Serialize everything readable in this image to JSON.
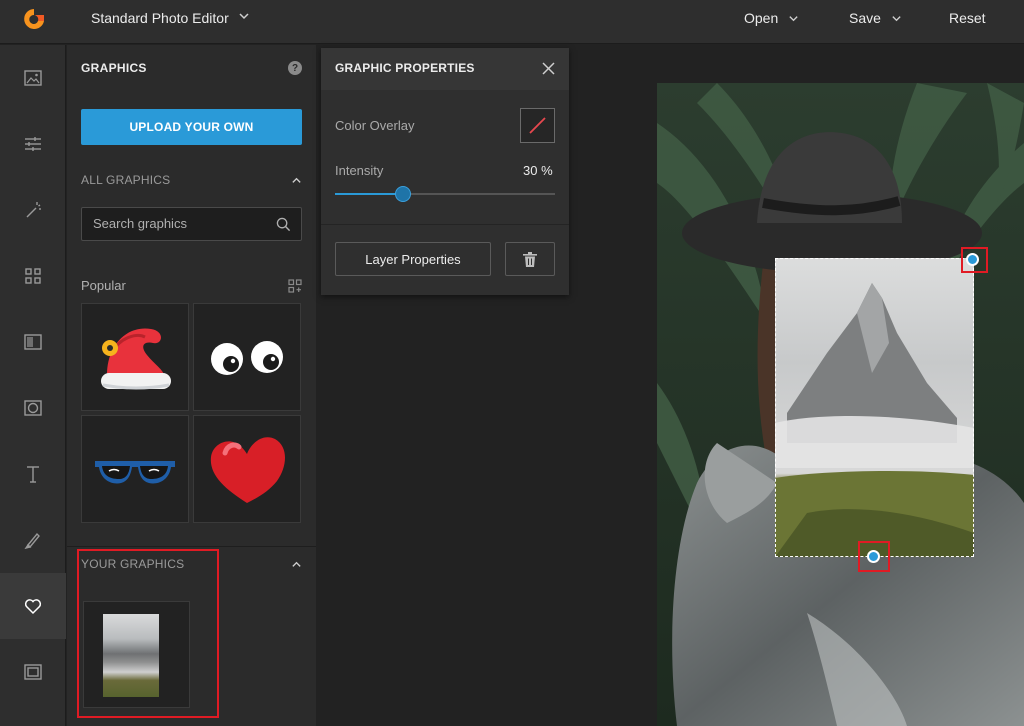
{
  "topbar": {
    "app_title": "Standard Photo Editor",
    "open_label": "Open",
    "save_label": "Save",
    "reset_label": "Reset",
    "accent_color": "#f7931e"
  },
  "rail": {
    "items": [
      {
        "icon": "image-icon"
      },
      {
        "icon": "sliders-icon"
      },
      {
        "icon": "magic-wand-icon"
      },
      {
        "icon": "grid-icon"
      },
      {
        "icon": "overlay-icon"
      },
      {
        "icon": "vignette-icon"
      },
      {
        "icon": "text-icon"
      },
      {
        "icon": "brush-icon"
      },
      {
        "icon": "heart-icon",
        "active": true
      },
      {
        "icon": "frame-icon"
      }
    ]
  },
  "graphics_panel": {
    "title": "GRAPHICS",
    "help": "?",
    "upload_label": "UPLOAD YOUR OWN",
    "all_graphics_label": "ALL GRAPHICS",
    "search_placeholder": "Search graphics",
    "popular_label": "Popular",
    "popular_items": [
      "santa-hat",
      "googly-eyes",
      "sunglasses",
      "heart"
    ],
    "your_graphics_label": "YOUR GRAPHICS"
  },
  "graphic_properties": {
    "title": "GRAPHIC PROPERTIES",
    "color_overlay_label": "Color Overlay",
    "intensity_label": "Intensity",
    "intensity_value": "30 %",
    "intensity_fraction": 0.31,
    "layer_properties_label": "Layer Properties"
  },
  "colors": {
    "accent_blue": "#2a9ad8",
    "highlight_red": "#e01b24"
  }
}
